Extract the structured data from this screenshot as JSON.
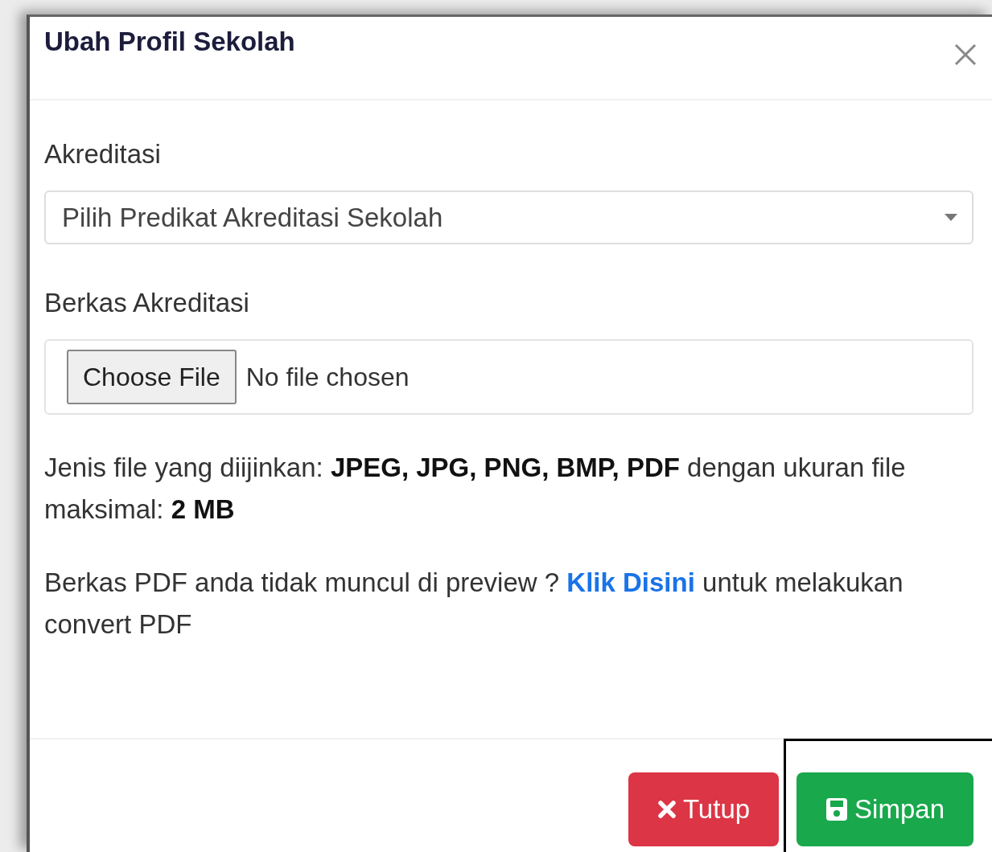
{
  "modal": {
    "title": "Ubah Profil Sekolah"
  },
  "fields": [
    {
      "kind": "select",
      "label": "Akreditasi",
      "placeholder": "Pilih Predikat Akreditasi Sekolah"
    },
    {
      "kind": "file",
      "label": "Berkas Akreditasi",
      "button": "Choose File",
      "status": "No file chosen"
    }
  ],
  "notes": [
    {
      "text": "Jenis file yang diijinkan: **JPEG, JPG, PNG, BMP, PDF** dengan ukuran file maksimal: **2 MB**"
    },
    {
      "text": "Berkas PDF anda tidak muncul di preview ?",
      "link": "Klik Disini",
      "after": "untuk melakukan convert PDF"
    }
  ],
  "buttons": [
    {
      "label": "Tutup",
      "kind": "danger",
      "highlighted": false
    },
    {
      "label": "Simpan",
      "kind": "success",
      "highlighted": true
    }
  ]
}
